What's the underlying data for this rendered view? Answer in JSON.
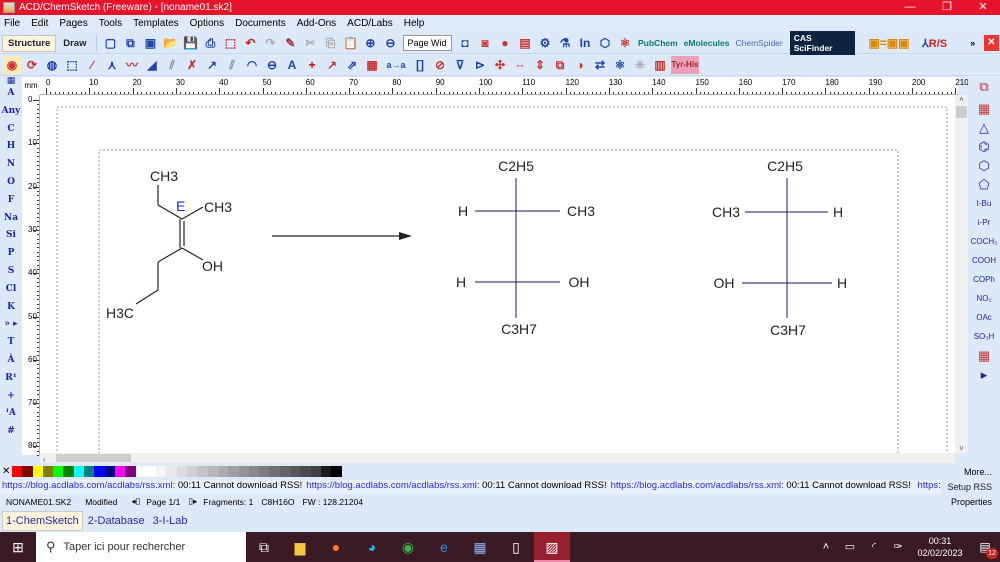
{
  "window": {
    "title": "ACD/ChemSketch (Freeware) - [noname01.sk2]",
    "minimize": "—",
    "maximize": "❐",
    "close": "✕"
  },
  "menu": [
    "File",
    "Edit",
    "Pages",
    "Tools",
    "Templates",
    "Options",
    "Documents",
    "Add-Ons",
    "ACD/Labs",
    "Help"
  ],
  "toolbar1": {
    "structure": "Structure",
    "draw": "Draw",
    "zoom_select": "Page Wid",
    "pubchem": "PubChem",
    "emolecules": "eMolecules",
    "chemspider": "ChemSpider",
    "cas": "CAS SciFinder",
    "rs": "R/S"
  },
  "toolbar1_icons": [
    {
      "name": "new-page-icon",
      "g": "▢",
      "c": "#2244aa"
    },
    {
      "name": "copy-page-icon",
      "g": "⧉",
      "c": "#2244aa"
    },
    {
      "name": "delete-page-icon",
      "g": "▣",
      "c": "#2244aa"
    },
    {
      "name": "open-icon",
      "g": "📂",
      "c": "#d23"
    },
    {
      "name": "save-icon",
      "g": "💾",
      "c": "#2244aa"
    },
    {
      "name": "print-icon",
      "g": "⎙",
      "c": "#2244aa"
    },
    {
      "name": "pdf-icon",
      "g": "⬚",
      "c": "#d23"
    },
    {
      "name": "undo-icon",
      "g": "↶",
      "c": "#c22"
    },
    {
      "name": "redo-icon",
      "g": "↷",
      "c": "#aaa"
    },
    {
      "name": "clean-icon",
      "g": "✎",
      "c": "#a33"
    },
    {
      "name": "cut-icon",
      "g": "✂",
      "c": "#aaa"
    },
    {
      "name": "copy-icon",
      "g": "⎘",
      "c": "#aaa"
    },
    {
      "name": "paste-icon",
      "g": "📋",
      "c": "#2244aa"
    },
    {
      "name": "zoom-in-icon",
      "g": "⊕",
      "c": "#2244aa"
    },
    {
      "name": "zoom-out-icon",
      "g": "⊖",
      "c": "#2244aa"
    }
  ],
  "toolbar1_icons2": [
    {
      "name": "3d-view-icon",
      "g": "◘",
      "c": "#2244aa"
    },
    {
      "name": "image-icon",
      "g": "◙",
      "c": "#c33"
    },
    {
      "name": "molecule-3d-icon",
      "g": "●",
      "c": "#c33"
    },
    {
      "name": "spectrum-icon",
      "g": "▤",
      "c": "#c33"
    },
    {
      "name": "properties-icon",
      "g": "⚙",
      "c": "#2244aa"
    },
    {
      "name": "name-icon",
      "g": "⚗",
      "c": "#2244aa"
    },
    {
      "name": "inchi-icon",
      "g": "In",
      "c": "#2244aa"
    },
    {
      "name": "smiles-icon",
      "g": "⬡",
      "c": "#2244aa"
    },
    {
      "name": "tautomer-icon",
      "g": "⚛",
      "c": "#c33"
    }
  ],
  "toolbar2_icons": [
    {
      "name": "select-icon",
      "g": "◉",
      "c": "#c33"
    },
    {
      "name": "rotate-icon",
      "g": "⟳",
      "c": "#c33"
    },
    {
      "name": "3d-rotate-icon",
      "g": "◍",
      "c": "#2244aa"
    },
    {
      "name": "lasso-select-icon",
      "g": "⬚",
      "c": "#2244aa"
    },
    {
      "name": "chain-icon",
      "g": "∕",
      "c": "#c33"
    },
    {
      "name": "branch-icon",
      "g": "⋏",
      "c": "#2244aa"
    },
    {
      "name": "chain-draw-icon",
      "g": "〰",
      "c": "#c33"
    },
    {
      "name": "wedge-bond-icon",
      "g": "◢",
      "c": "#2244aa"
    },
    {
      "name": "hash-bond-icon",
      "g": "⫽",
      "c": "#88a"
    },
    {
      "name": "bond-type-icon",
      "g": "✗",
      "c": "#c33"
    },
    {
      "name": "arrow-bond-icon",
      "g": "↗",
      "c": "#2244aa"
    },
    {
      "name": "dative-bond-icon",
      "g": "⫽",
      "c": "#88a"
    },
    {
      "name": "ring-icon",
      "g": "◠",
      "c": "#2244aa"
    },
    {
      "name": "atom-ring-icon",
      "g": "⊖",
      "c": "#2244aa"
    },
    {
      "name": "text-format-icon",
      "g": "A",
      "c": "#2244aa"
    },
    {
      "name": "charge-icon",
      "g": "+",
      "c": "#d00"
    },
    {
      "name": "reaction-arrow-icon",
      "g": "↗",
      "c": "#c33"
    },
    {
      "name": "reaction-center-icon",
      "g": "⇗",
      "c": "#2244aa"
    },
    {
      "name": "table-icon",
      "g": "▦",
      "c": "#c33"
    },
    {
      "name": "atom-mapping-icon",
      "g": "a→a",
      "c": "#2244aa"
    },
    {
      "name": "brackets-icon",
      "g": "[]",
      "c": "#2244aa"
    },
    {
      "name": "remove-explicit-icon",
      "g": "⊘",
      "c": "#c33"
    },
    {
      "name": "flip-top-icon",
      "g": "⊽",
      "c": "#2244aa"
    },
    {
      "name": "flip-left-icon",
      "g": "⊳",
      "c": "#2244aa"
    },
    {
      "name": "flip-icon",
      "g": "✣",
      "c": "#c33"
    },
    {
      "name": "rotate-horizontal-icon",
      "g": "⇔",
      "c": "#c33"
    },
    {
      "name": "rotate-vertical-icon",
      "g": "⇕",
      "c": "#c33"
    },
    {
      "name": "group-icon",
      "g": "⧉",
      "c": "#c33"
    },
    {
      "name": "clean-structure-icon",
      "g": "◑",
      "c": "#d22"
    },
    {
      "name": "add-hydrogens-icon",
      "g": "⇄",
      "c": "#2244aa"
    },
    {
      "name": "structure-3d-icon",
      "g": "⚛",
      "c": "#2244aa"
    },
    {
      "name": "stereo-icon",
      "g": "✳",
      "c": "#aaa"
    },
    {
      "name": "check-icon",
      "g": "▥",
      "c": "#c33"
    }
  ],
  "toolbar2_peptide": "Tyr-His",
  "left_toolbar": [
    "A",
    "Any",
    "C",
    "H",
    "N",
    "O",
    "F",
    "Na",
    "Si",
    "P",
    "S",
    "Cl",
    "K",
    "» ▸",
    "T",
    "Ȧ",
    "R¹",
    "+",
    "ᴵA",
    "#"
  ],
  "right_toolbar": [
    "▦",
    "△",
    "⌬",
    "⬡",
    "⬠",
    "t-Bu",
    "i-Pr",
    "COCH₃",
    "COOH",
    "COPh",
    "NO₂",
    "OAc",
    "SO₃H",
    "▦",
    "▸"
  ],
  "ruler": {
    "unit": "mm",
    "h_labels": [
      "0",
      "10",
      "20",
      "30",
      "40",
      "50",
      "60",
      "70",
      "80",
      "90",
      "100",
      "110",
      "120",
      "130",
      "140",
      "150",
      "160",
      "170",
      "180",
      "190",
      "200",
      "210"
    ],
    "v_labels": [
      "0",
      "10",
      "20",
      "30",
      "40",
      "50",
      "60",
      "70",
      "80"
    ]
  },
  "molecule": {
    "ch3_top": "CH3",
    "ch3_right": "CH3",
    "stereo": "E",
    "oh": "OH",
    "h3c": "H3C"
  },
  "fischer1": {
    "top": "C2H5",
    "left1": "H",
    "right1": "CH3",
    "left2": "H",
    "right2": "OH",
    "bottom": "C3H7"
  },
  "fischer2": {
    "top": "C2H5",
    "left1": "CH3",
    "right1": "H",
    "left2": "OH",
    "right2": "H",
    "bottom": "C3H7"
  },
  "palette": [
    "#ff0000",
    "#800000",
    "#ffff00",
    "#808000",
    "#00ff00",
    "#008000",
    "#00ffff",
    "#008080",
    "#0000ff",
    "#000080",
    "#ff00ff",
    "#800080",
    "#ffffff",
    "#ffffff",
    "#f4f4f4",
    "#e8e8e8",
    "#dcdcdc",
    "#d0d0d0",
    "#c4c4c4",
    "#b8b8b8",
    "#acacac",
    "#a0a0a0",
    "#949494",
    "#888888",
    "#7c7c7c",
    "#707070",
    "#646464",
    "#585858",
    "#4c4c4c",
    "#404040",
    "#1a1a1a",
    "#000000"
  ],
  "palette_more": "More...",
  "rss": {
    "link": "https://blog.acdlabs.com/acdlabs/rss.xml:",
    "msg": " 00:11 Cannot download RSS!",
    "tail": "https://blog.acdlal",
    "setup": "Setup RSS"
  },
  "status": {
    "file": "NONAME01.SK2",
    "modified": "Modified",
    "page": "Page 1/1",
    "fragments": "Fragments: 1",
    "formula": "C8H16O",
    "fw": "FW : 128.21204",
    "properties": "Properties"
  },
  "tabs": [
    "1-ChemSketch",
    "2-Database",
    "3-I-Lab"
  ],
  "taskbar": {
    "search_placeholder": "Taper ici pour rechercher",
    "time": "00:31",
    "date": "02/02/2023",
    "notifications": "12"
  }
}
